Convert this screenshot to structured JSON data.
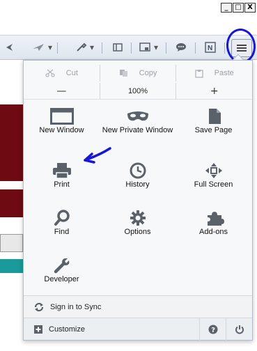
{
  "window": {
    "minimize_glyph": "_",
    "restore_glyph": "□",
    "close_glyph": "X"
  },
  "colors": {
    "annotation": "#1616d8",
    "icon_gray": "#5a6169",
    "background_dark_red": "#6d0a12",
    "background_teal": "#1a9a9a"
  },
  "toolbar": {
    "icons": [
      "back-arrow-icon",
      "bookmark-plane-icon",
      "tools-wrench-icon",
      "sidebar-icon",
      "screenshot-icon",
      "chat-bubble-icon",
      "onenote-icon",
      "hamburger-menu-icon"
    ]
  },
  "panel": {
    "edit": {
      "cut": "Cut",
      "copy": "Copy",
      "paste": "Paste"
    },
    "zoom": {
      "minus": "—",
      "value": "100%",
      "plus": "+"
    },
    "tiles": [
      {
        "label": "New Window",
        "icon": "window-icon"
      },
      {
        "label": "New Private Window",
        "icon": "private-mask-icon"
      },
      {
        "label": "Save Page",
        "icon": "page-icon"
      },
      {
        "label": "Print",
        "icon": "printer-icon"
      },
      {
        "label": "History",
        "icon": "clock-icon"
      },
      {
        "label": "Full Screen",
        "icon": "fullscreen-icon"
      },
      {
        "label": "Find",
        "icon": "magnifier-icon"
      },
      {
        "label": "Options",
        "icon": "gear-icon"
      },
      {
        "label": "Add-ons",
        "icon": "puzzle-icon"
      },
      {
        "label": "Developer",
        "icon": "wrench-icon"
      }
    ],
    "sync_label": "Sign in to Sync",
    "customize_label": "Customize"
  }
}
